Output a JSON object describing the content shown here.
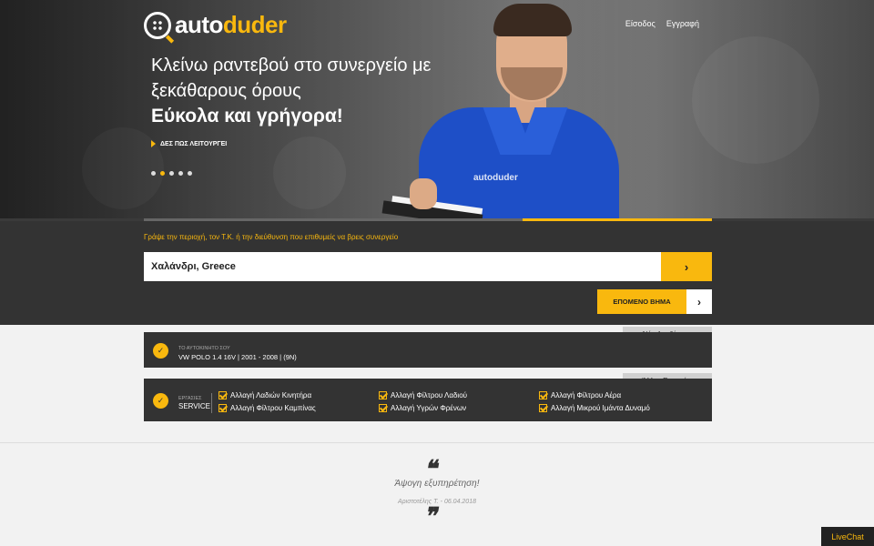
{
  "brand": {
    "logo_part1": "auto",
    "logo_part2": "duder",
    "accent": "#f9b80e",
    "dark": "#333333"
  },
  "nav": {
    "login": "Είσοδος",
    "register": "Εγγραφή"
  },
  "hero": {
    "line1": "Κλείνω ραντεβού στο συνεργείο με",
    "line2": "ξεκάθαρους όρους",
    "line3": "Εύκολα και γρήγορα!",
    "how_it_works": "ΔΕΣ ΠΩΣ ΛΕΙΤΟΥΡΓΕΙ",
    "jacket_badge": "autoduder",
    "slides_total": 5,
    "slide_active": 2
  },
  "search": {
    "hint": "Γράψε την περιοχή, τον Τ.Κ. ή την διεύθυνση που επιθυμείς να βρεις συνεργείο",
    "value": "Χαλάνδρι, Greece",
    "go_icon": "chevron-right-icon",
    "next_label": "ΕΠΟΜΕΝΟ ΒΗΜΑ",
    "next_icon": "chevron-right-icon"
  },
  "car": {
    "new_search": "Νέα Αναζήτηση",
    "label": "ΤΟ ΑΥΤΟΚΙΝΗΤΟ ΣΟΥ",
    "value": "VW POLO 1.4 16V | 2001 - 2008 | (9N)"
  },
  "services": {
    "other_services": "Άλλες Εργασίες",
    "label": "ΕΡΓΑΣΙΕΣ",
    "value": "SERVICE",
    "items": [
      "Αλλαγή Λαδιών Κινητήρα",
      "Αλλαγή Φίλτρου Λαδιού",
      "Αλλαγή Φίλτρου Αέρα",
      "Αλλαγή Φίλτρου Καμπίνας",
      "Αλλαγή Υγρών Φρένων",
      "Αλλαγή Μικρού Ιμάντα Δυναμό"
    ]
  },
  "testimonial": {
    "text": "Άψογη εξυπηρέτηση!",
    "author": "Αριστοτέλης Τ. - 06.04.2018"
  },
  "livechat": "LiveChat"
}
